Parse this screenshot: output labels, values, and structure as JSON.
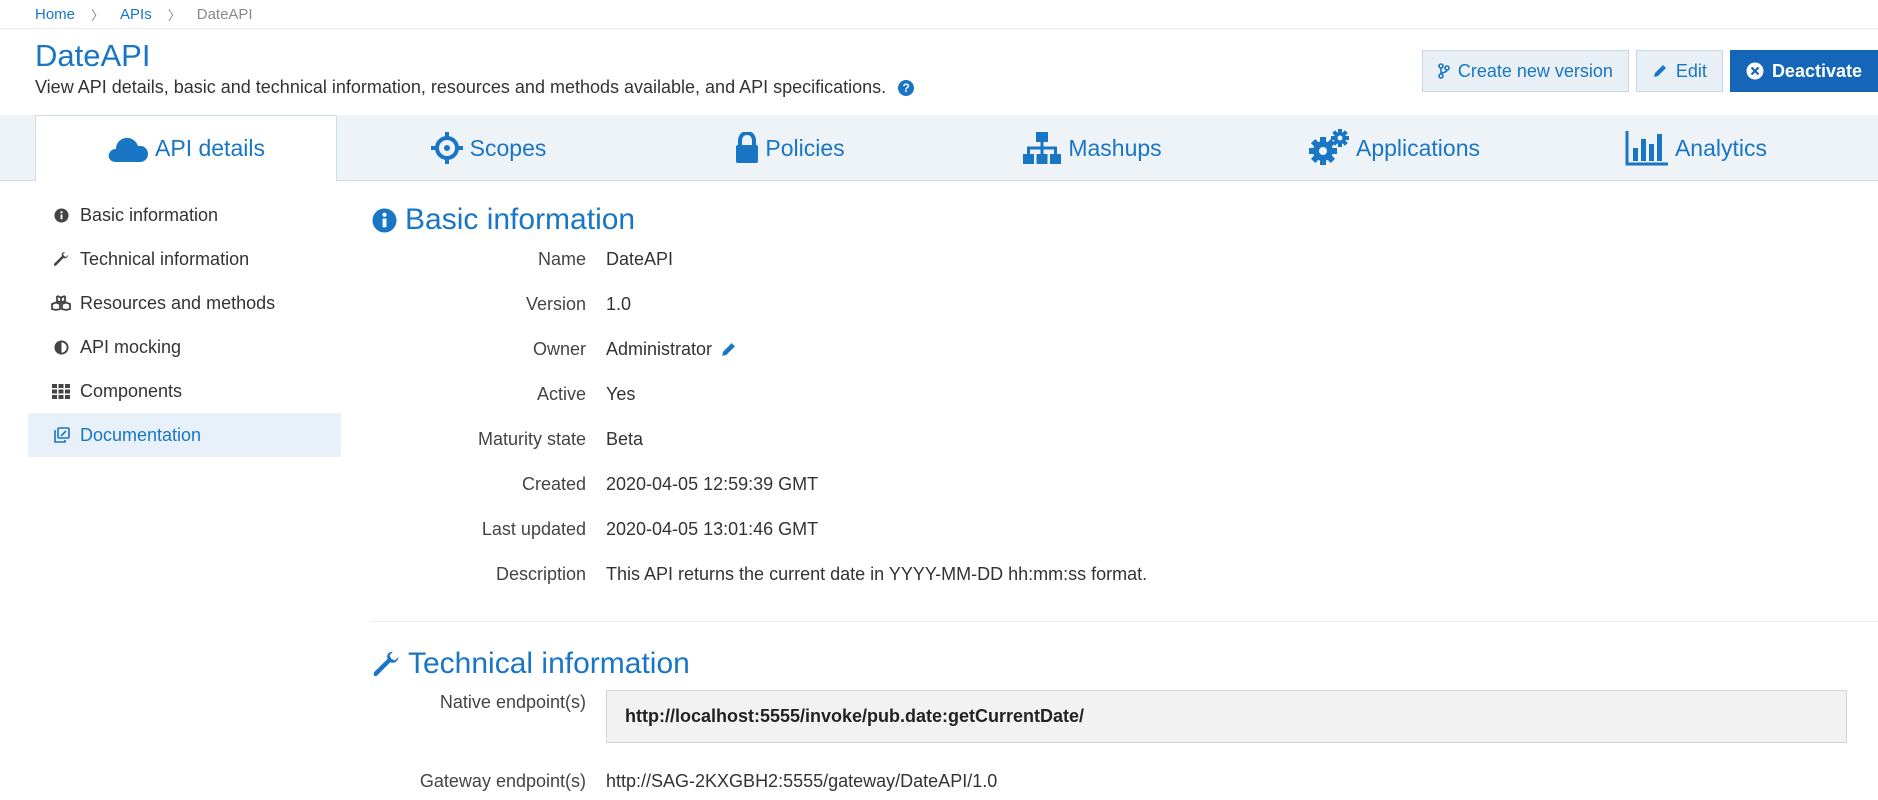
{
  "breadcrumb": {
    "home": "Home",
    "apis": "APIs",
    "current": "DateAPI",
    "sep": "〉"
  },
  "header": {
    "title": "DateAPI",
    "subtitle": "View API details, basic and technical information, resources and methods available, and API specifications.",
    "help": "?"
  },
  "actions": {
    "create_version": "Create new version",
    "edit": "Edit",
    "deactivate": "Deactivate"
  },
  "tabs": [
    {
      "label": "API details",
      "icon": "cloud-icon"
    },
    {
      "label": "Scopes",
      "icon": "crosshair-icon"
    },
    {
      "label": "Policies",
      "icon": "lock-icon"
    },
    {
      "label": "Mashups",
      "icon": "sitemap-icon"
    },
    {
      "label": "Applications",
      "icon": "gears-icon"
    },
    {
      "label": "Analytics",
      "icon": "bar-chart-icon"
    }
  ],
  "sidebar": {
    "items": [
      {
        "label": "Basic information",
        "icon": "info-icon"
      },
      {
        "label": "Technical information",
        "icon": "wrench-icon"
      },
      {
        "label": "Resources and methods",
        "icon": "cubes-icon"
      },
      {
        "label": "API mocking",
        "icon": "half-circle-icon"
      },
      {
        "label": "Components",
        "icon": "grid-icon"
      },
      {
        "label": "Documentation",
        "icon": "documents-icon"
      }
    ]
  },
  "basic_info": {
    "title": "Basic information",
    "fields": [
      {
        "label": "Name",
        "value": "DateAPI"
      },
      {
        "label": "Version",
        "value": "1.0"
      },
      {
        "label": "Owner",
        "value": "Administrator"
      },
      {
        "label": "Active",
        "value": "Yes"
      },
      {
        "label": "Maturity state",
        "value": "Beta"
      },
      {
        "label": "Created",
        "value": "2020-04-05 12:59:39 GMT"
      },
      {
        "label": "Last updated",
        "value": "2020-04-05 13:01:46 GMT"
      },
      {
        "label": "Description",
        "value": "This API returns the current date in YYYY-MM-DD hh:mm:ss format."
      }
    ]
  },
  "technical_info": {
    "title": "Technical information",
    "native_label": "Native endpoint(s)",
    "native_value": "http://localhost:5555/invoke/pub.date:getCurrentDate/",
    "gateway_label": "Gateway endpoint(s)",
    "gateway_value": "http://SAG-2KXGBH2:5555/gateway/DateAPI/1.0"
  },
  "colors": {
    "accent": "#1976c5",
    "primary_button": "#1565b8",
    "tabbar_bg": "#eef3f7",
    "active_side_bg": "#e8f1f9"
  }
}
